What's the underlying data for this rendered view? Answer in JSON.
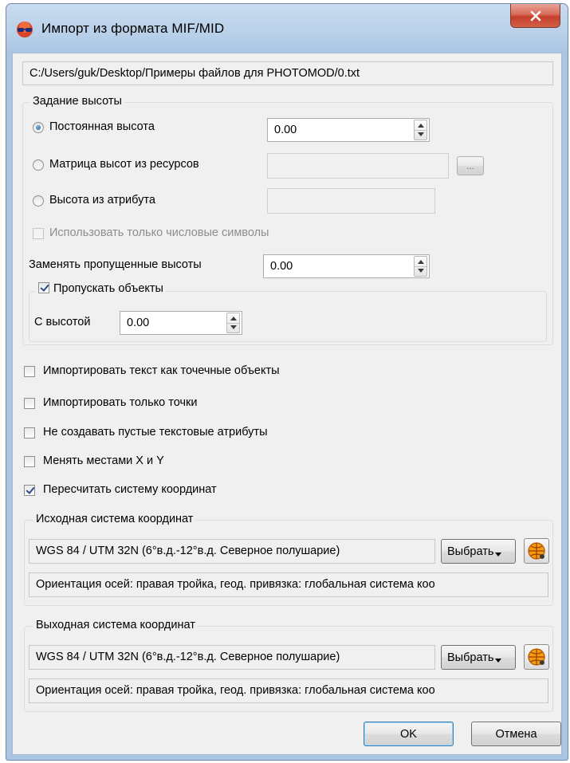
{
  "window": {
    "title": "Импорт из формата MIF/MID"
  },
  "file_path": "C:/Users/guk/Desktop/Примеры файлов для PHOTOMOD/0.txt",
  "height_group": {
    "legend": "Задание высоты",
    "constant_label": "Постоянная высота",
    "constant_value": "0.00",
    "matrix_label": "Матрица высот из ресурсов",
    "browse_label": "...",
    "attribute_label": "Высота из атрибута",
    "numeric_only_label": "Использовать только числовые символы",
    "replace_missing_label": "Заменять пропущенные высоты",
    "replace_missing_value": "0.00",
    "skip_objects": {
      "legend": "Пропускать объекты",
      "with_height_label": "С высотой",
      "with_height_value": "0.00"
    }
  },
  "options": {
    "import_text_points": "Импортировать текст как точечные объекты",
    "import_points_only": "Импортировать только точки",
    "no_empty_text_attrs": "Не создавать пустые текстовые атрибуты",
    "swap_xy": "Менять местами X и Y",
    "recalc_coords": "Пересчитать систему координат"
  },
  "source_cs": {
    "legend": "Исходная система координат",
    "name": "WGS 84 / UTM 32N (6°в.д.-12°в.д. Северное полушарие)",
    "choose_label": "Выбрать",
    "info": "Ориентация осей: правая тройка, геод. привязка: глобальная система коо"
  },
  "target_cs": {
    "legend": "Выходная система координат",
    "name": "WGS 84 / UTM 32N (6°в.д.-12°в.д. Северное полушарие)",
    "choose_label": "Выбрать",
    "info": "Ориентация осей: правая тройка, геод. привязка: глобальная система коо"
  },
  "buttons": {
    "ok": "OK",
    "cancel": "Отмена"
  },
  "colors": {
    "title_bg": "#b7cfe8",
    "client_bg": "#f0f0f0",
    "close_red": "#c4402c",
    "check_blue": "#2a4d86"
  }
}
